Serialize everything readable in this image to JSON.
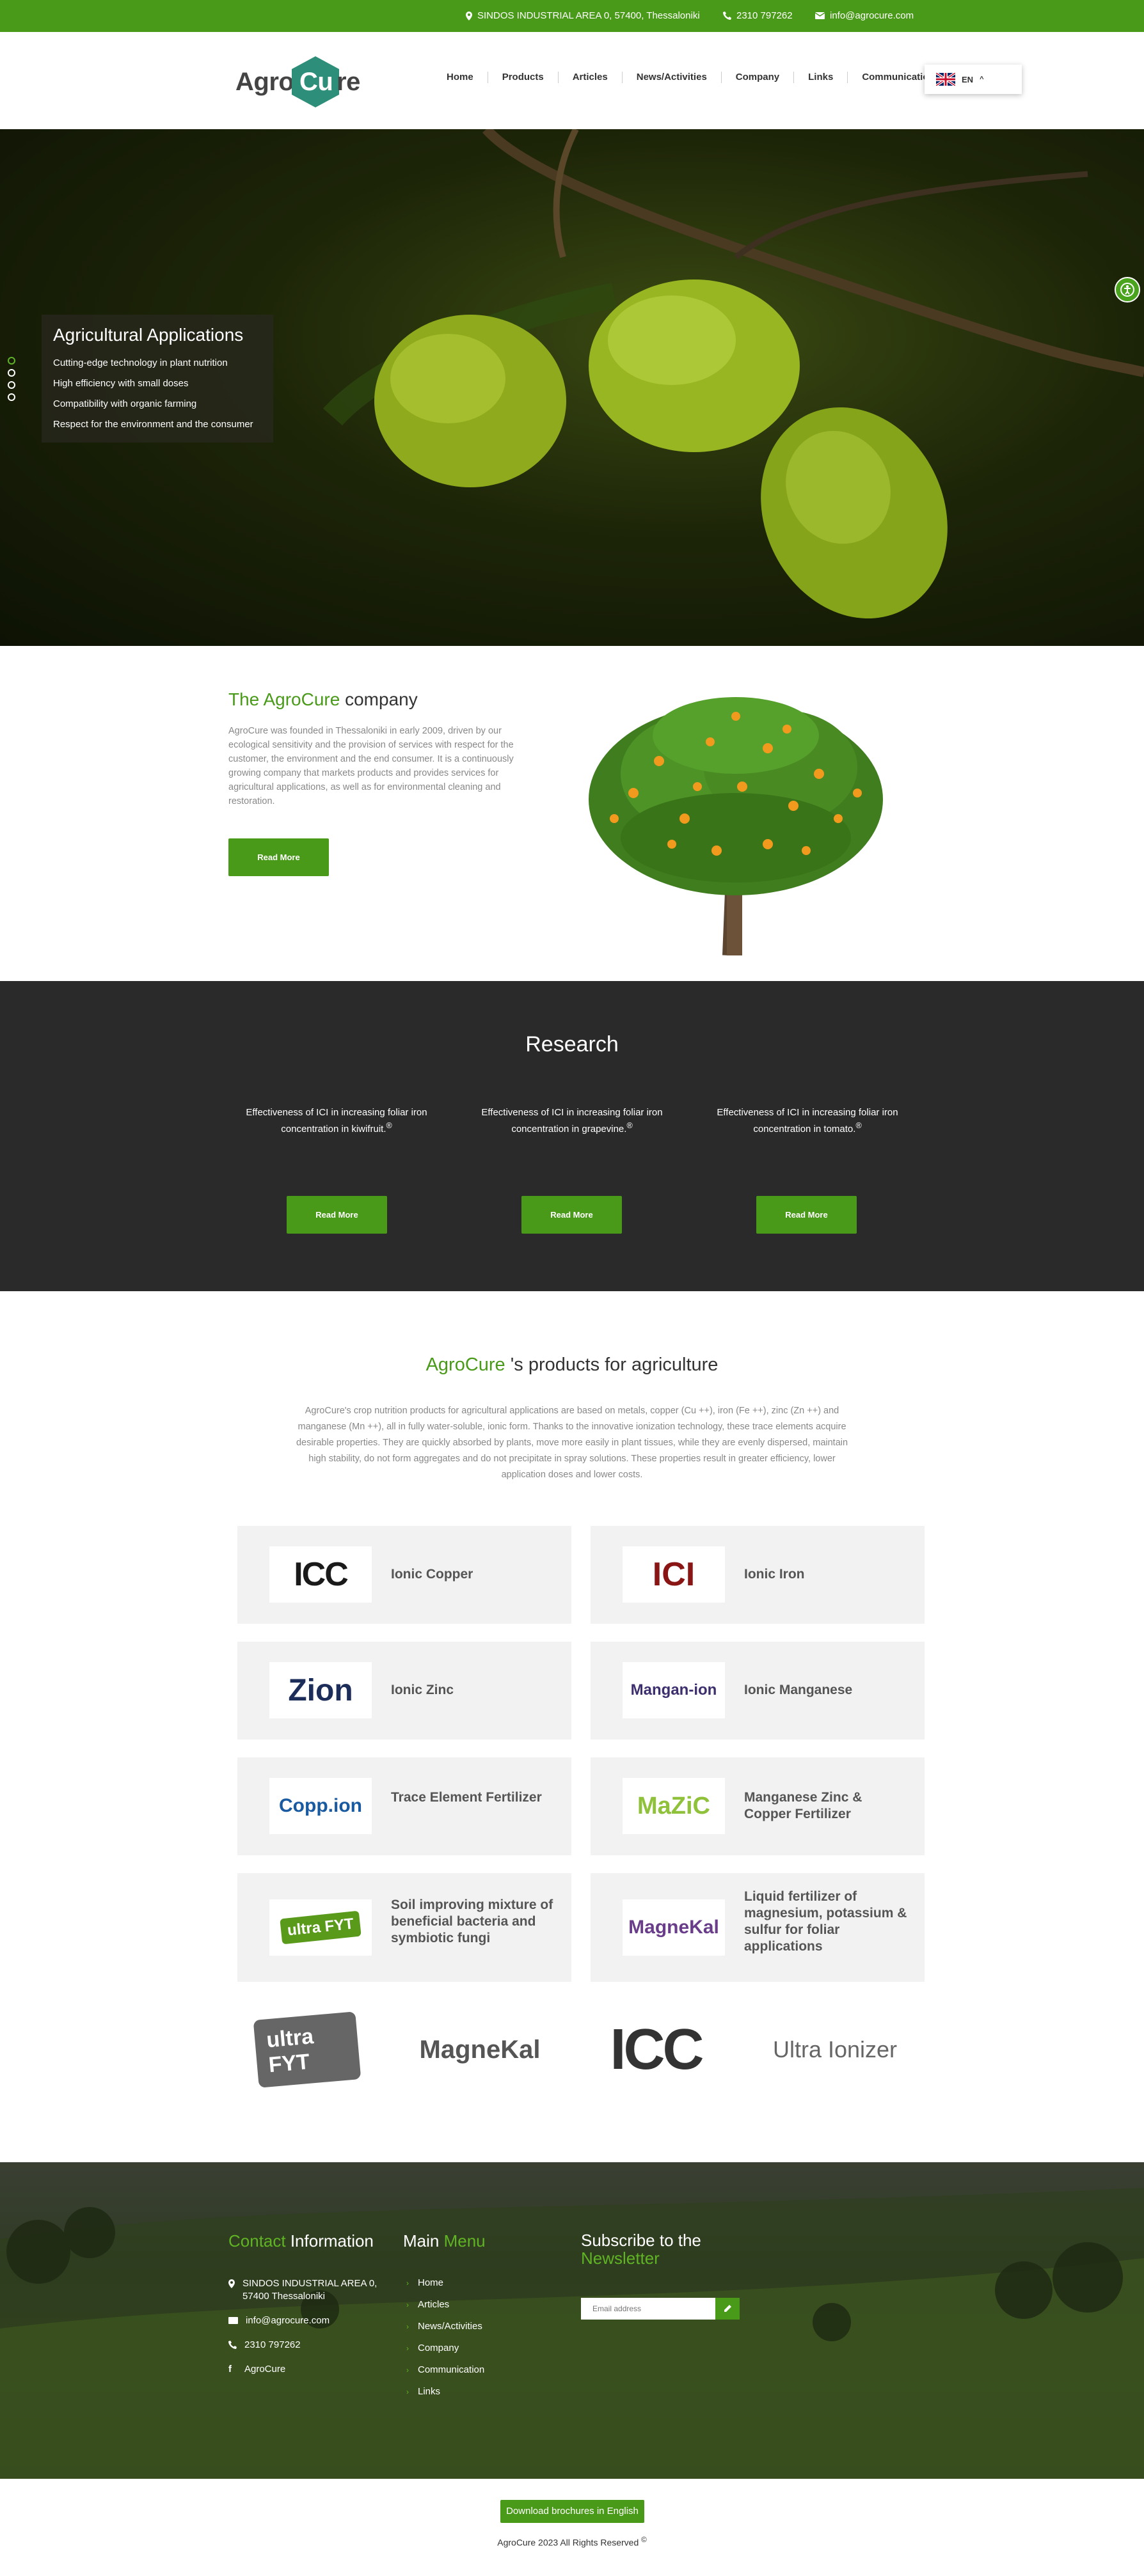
{
  "topbar": {
    "address": "SINDOS INDUSTRIAL AREA 0, 57400, Thessaloniki",
    "phone": "2310 797262",
    "email": "info@agrocure.com",
    "color": "#4a9a19"
  },
  "header": {
    "logo_part1": "Agro",
    "logo_part2": "Cu",
    "logo_part3": "re",
    "nav": [
      "Home",
      "Products",
      "Articles",
      "News/Activities",
      "Company",
      "Links",
      "Communication"
    ],
    "lang": "EN"
  },
  "hero": {
    "title": "Agricultural Applications",
    "bullets": [
      "Cutting-edge technology in plant nutrition",
      "High efficiency with small doses",
      "Compatibility with organic farming",
      "Respect for the environment and the consumer"
    ]
  },
  "company": {
    "title_green": "The AgroCure",
    "title_rest": " company",
    "text": "AgroCure was founded in Thessaloniki in early 2009, driven by our ecological sensitivity and the provision of services with respect for the customer, the environment and the end consumer. It is a continuously growing company that markets products and provides services for agricultural applications, as well as for environmental cleaning and restoration.",
    "button": "Read More"
  },
  "research": {
    "title": "Research",
    "items": [
      {
        "text": "Effectiveness of ICI in increasing foliar iron concentration in kiwifruit.",
        "sup": "®",
        "button": "Read More"
      },
      {
        "text": "Effectiveness of ICI in increasing foliar iron concentration in grapevine.",
        "sup": "®",
        "button": "Read More"
      },
      {
        "text": "Effectiveness of ICI in increasing foliar iron concentration in tomato.",
        "sup": "®",
        "button": "Read More"
      }
    ]
  },
  "products": {
    "title_green": "AgroCure",
    "title_rest": " 's products for agriculture",
    "text": "AgroCure's crop nutrition products for agricultural applications are based on metals, copper (Cu ++), iron (Fe ++), zinc (Zn ++) and manganese (Mn ++), all in fully water-soluble, ionic form. Thanks to the innovative ionization technology, these trace elements acquire desirable properties. They are quickly absorbed by plants, move more easily in plant tissues, while they are evenly dispersed, maintain high stability, do not form aggregates and do not precipitate in spray solutions. These properties result in greater efficiency, lower application doses and lower costs.",
    "cards": [
      {
        "label": "Ionic Copper",
        "logo": "ICC",
        "icon": "icc-logo"
      },
      {
        "label": "Ionic Iron",
        "logo": "ICI",
        "icon": "ici-logo"
      },
      {
        "label": "Ionic Zinc",
        "logo": "Zion",
        "icon": "zion-logo"
      },
      {
        "label": "Ionic Manganese",
        "logo": "Mangan-ion",
        "icon": "mangan-ion-logo"
      },
      {
        "label": "Trace Element Fertilizer",
        "logo": "Copp.ion",
        "icon": "copp-ion-logo"
      },
      {
        "label": "Manganese Zinc & Copper Fertilizer",
        "logo": "MaZiC",
        "icon": "mazic-logo"
      },
      {
        "label": "Soil improving mixture of beneficial bacteria and symbiotic fungi",
        "logo": "ultra FYT",
        "icon": "ultra-fyt-logo"
      },
      {
        "label": "Liquid fertilizer of magnesium, potassium & sulfur for foliar applications",
        "logo": "MagneKal",
        "icon": "magnekal-logo"
      }
    ],
    "brands": [
      "ultra FYT",
      "MagneKal",
      "ICC",
      "Ultra Ionizer"
    ]
  },
  "footer": {
    "contact_green": "Contact",
    "contact_rest": " Information",
    "address": "SINDOS INDUSTRIAL AREA 0, 57400        Thessaloniki",
    "email": "info@agrocure.com",
    "phone": "2310 797262",
    "facebook": "AgroCure",
    "menu_white": "Main",
    "menu_green": " Menu",
    "menu": [
      "Home",
      "Articles",
      "News/Activities",
      "Company",
      "Communication",
      "Links"
    ],
    "newsletter_white": "Subscribe to the",
    "newsletter_green": "Newsletter",
    "email_placeholder": "Email address",
    "brochure": "Download brochures in English",
    "copyright": "AgroCure 2023 All Rights Reserved"
  }
}
